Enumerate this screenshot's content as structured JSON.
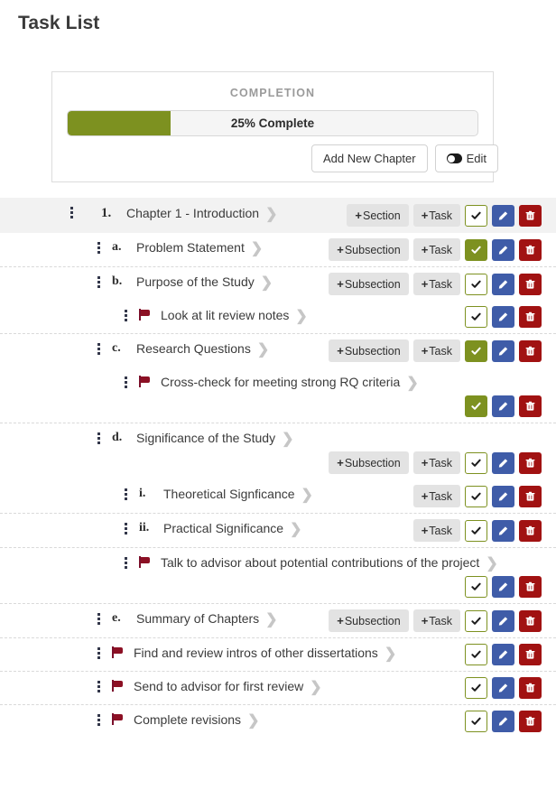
{
  "page": {
    "title": "Task List"
  },
  "completion_panel": {
    "label": "COMPLETION",
    "progress_percent": 25,
    "progress_text": "25% Complete",
    "fill_color": "#7d9120",
    "add_chapter_label": "Add New Chapter",
    "edit_label": "Edit",
    "edit_toggle_state": "on"
  },
  "labels": {
    "add_section": "Section",
    "add_subsection": "Subsection",
    "add_task": "Task",
    "plus": "+",
    "chevron": "❯"
  },
  "colors": {
    "check_on": "#7d9120",
    "check_off_border": "#7d9120",
    "edit": "#3f5ca8",
    "delete": "#a11212",
    "flag": "#8c1024",
    "chapter_row_bg": "#f2f2f2"
  },
  "rows": [
    {
      "kind": "chapter",
      "level": 0,
      "marker": "1.",
      "title": "Chapter 1 - Introduction",
      "add_buttons": [
        "Section",
        "Task"
      ],
      "checked": false,
      "divider": false,
      "wrapped": false
    },
    {
      "kind": "section",
      "level": 1,
      "marker": "a.",
      "title": "Problem Statement",
      "add_buttons": [
        "Subsection",
        "Task"
      ],
      "checked": true,
      "divider": false,
      "wrapped": false
    },
    {
      "kind": "section",
      "level": 1,
      "marker": "b.",
      "title": "Purpose of the Study",
      "add_buttons": [
        "Subsection",
        "Task"
      ],
      "checked": false,
      "divider": true,
      "wrapped": false
    },
    {
      "kind": "task",
      "level": 2,
      "marker": "",
      "title": "Look at lit review notes",
      "add_buttons": [],
      "checked": false,
      "divider": false,
      "wrapped": false
    },
    {
      "kind": "section",
      "level": 1,
      "marker": "c.",
      "title": "Research Questions",
      "add_buttons": [
        "Subsection",
        "Task"
      ],
      "checked": true,
      "divider": true,
      "wrapped": false
    },
    {
      "kind": "task",
      "level": 2,
      "marker": "",
      "title": "Cross-check for meeting strong RQ criteria",
      "add_buttons": [],
      "checked": true,
      "divider": false,
      "wrapped": true
    },
    {
      "kind": "section",
      "level": 1,
      "marker": "d.",
      "title": "Significance of the Study",
      "add_buttons": [
        "Subsection",
        "Task"
      ],
      "checked": false,
      "divider": true,
      "wrapped": true
    },
    {
      "kind": "subsection",
      "level": 2,
      "marker": "i.",
      "title": "Theoretical Signficance",
      "add_buttons": [
        "Task"
      ],
      "checked": false,
      "divider": false,
      "wrapped": false
    },
    {
      "kind": "subsection",
      "level": 2,
      "marker": "ii.",
      "title": "Practical Significance",
      "add_buttons": [
        "Task"
      ],
      "checked": false,
      "divider": true,
      "wrapped": false
    },
    {
      "kind": "task",
      "level": 2,
      "marker": "",
      "title": "Talk to advisor about potential contributions of the project",
      "add_buttons": [],
      "checked": false,
      "divider": true,
      "wrapped": true
    },
    {
      "kind": "section",
      "level": 1,
      "marker": "e.",
      "title": "Summary of Chapters",
      "add_buttons": [
        "Subsection",
        "Task"
      ],
      "checked": false,
      "divider": true,
      "wrapped": false
    },
    {
      "kind": "task",
      "level": 1,
      "marker": "",
      "title": "Find and review intros of other dissertations",
      "add_buttons": [],
      "checked": false,
      "divider": true,
      "wrapped": false
    },
    {
      "kind": "task",
      "level": 1,
      "marker": "",
      "title": "Send to advisor for first review",
      "add_buttons": [],
      "checked": false,
      "divider": true,
      "wrapped": false
    },
    {
      "kind": "task",
      "level": 1,
      "marker": "",
      "title": "Complete revisions",
      "add_buttons": [],
      "checked": false,
      "divider": true,
      "wrapped": false
    }
  ]
}
